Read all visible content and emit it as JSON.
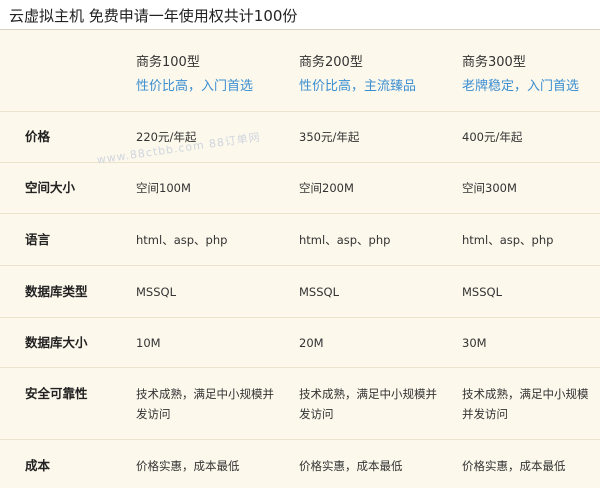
{
  "page": {
    "title": "云虚拟主机 免费申请一年使用权共计100份"
  },
  "plans": [
    {
      "name": "商务100型",
      "tagline": "性价比高，入门首选"
    },
    {
      "name": "商务200型",
      "tagline": "性价比高，主流臻品"
    },
    {
      "name": "商务300型",
      "tagline": "老牌稳定，入门首选"
    }
  ],
  "rows": [
    {
      "label": "价格",
      "values": [
        "220元/年起",
        "350元/年起",
        "400元/年起"
      ]
    },
    {
      "label": "空间大小",
      "values": [
        "空间100M",
        "空间200M",
        "空间300M"
      ]
    },
    {
      "label": "语言",
      "values": [
        "html、asp、php",
        "html、asp、php",
        "html、asp、php"
      ]
    },
    {
      "label": "数据库类型",
      "values": [
        "MSSQL",
        "MSSQL",
        "MSSQL"
      ]
    },
    {
      "label": "数据库大小",
      "values": [
        "10M",
        "20M",
        "30M"
      ]
    },
    {
      "label": "安全可靠性",
      "values": [
        "技术成熟，满足中小规模并发访问",
        "技术成熟，满足中小规模并发访问",
        "技术成熟，满足中小规模并发访问"
      ]
    },
    {
      "label": "成本",
      "values": [
        "价格实惠，成本最低",
        "价格实惠，成本最低",
        "价格实惠，成本最低"
      ]
    }
  ],
  "watermark": "www.88ctbb.com 88订单网"
}
